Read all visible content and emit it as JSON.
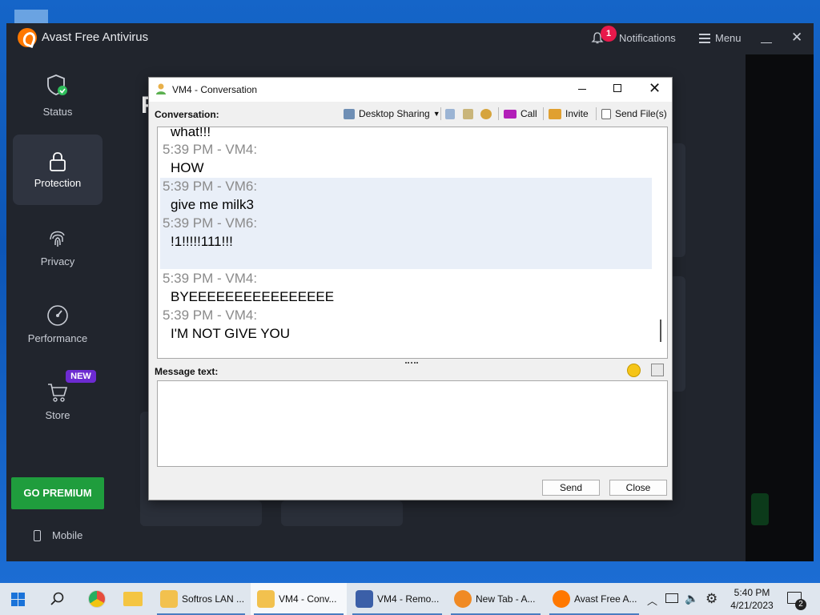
{
  "avast": {
    "title": "Avast Free Antivirus",
    "notifications_count": "1",
    "notifications_label": "Notifications",
    "menu_label": "Menu",
    "heading_letter": "F",
    "sidebar": [
      {
        "label": "Status"
      },
      {
        "label": "Protection"
      },
      {
        "label": "Privacy"
      },
      {
        "label": "Performance"
      },
      {
        "label": "Store"
      }
    ],
    "new_badge": "NEW",
    "go_premium": "GO PREMIUM",
    "mobile": "Mobile"
  },
  "conversation": {
    "title": "VM4 - Conversation",
    "conversation_label": "Conversation:",
    "toolbar": {
      "desktop_sharing": "Desktop Sharing",
      "call": "Call",
      "invite": "Invite",
      "send_files": "Send File(s)"
    },
    "messages": [
      {
        "text": "what!!!"
      },
      {
        "header": "5:39 PM - VM4:",
        "text": "HOW"
      },
      {
        "header": "5:39 PM - VM6:",
        "text": "give me milk3"
      },
      {
        "header": "5:39 PM - VM6:",
        "text": "!1!!!!!111!!!"
      },
      {
        "header": "5:39 PM - VM4:",
        "text": "BYEEEEEEEEEEEEEEEE"
      },
      {
        "header": "5:39 PM - VM4:",
        "text": "I'M NOT GIVE YOU"
      }
    ],
    "message_text_label": "Message text:",
    "message_value": "",
    "send_label": "Send",
    "close_label": "Close"
  },
  "taskbar": {
    "apps": [
      {
        "label": "Softros LAN ..."
      },
      {
        "label": "VM4 - Conv..."
      },
      {
        "label": "VM4 - Remo..."
      },
      {
        "label": "New Tab - A..."
      },
      {
        "label": "Avast Free A..."
      }
    ],
    "time": "5:40 PM",
    "date": "4/21/2023",
    "notification_count": "2"
  },
  "colors": {
    "avast_bg": "#21252d",
    "avast_orange": "#ff7800",
    "premium_green": "#1f9d3d",
    "new_badge": "#6d2bd1",
    "notif_badge": "#e8194b",
    "taskbar": "#dfe6ee"
  }
}
